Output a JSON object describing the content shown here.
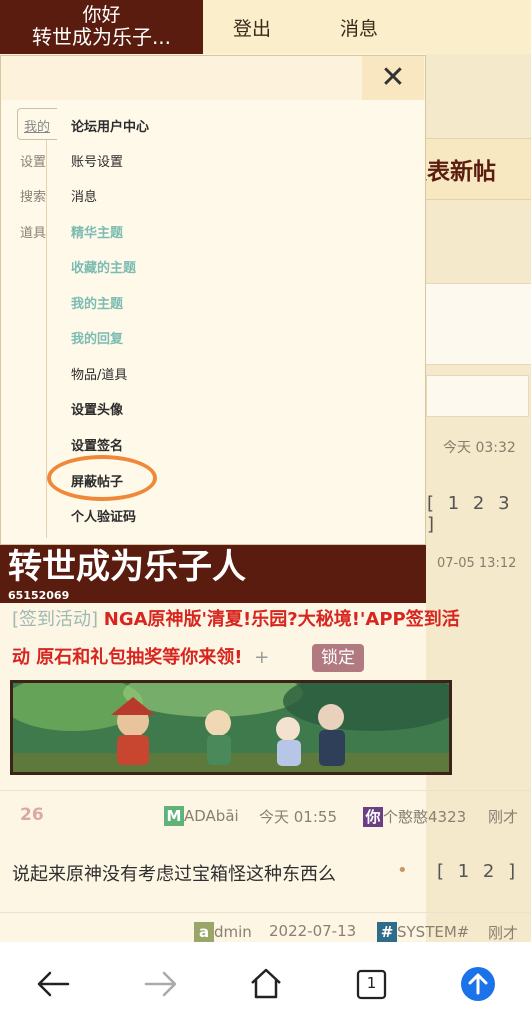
{
  "topbar": {
    "greeting": "你好",
    "username_short": "转世成为乐子...",
    "logout": "登出",
    "messages": "消息"
  },
  "background": {
    "post_button": "发表新帖",
    "date1": "今天 03:32",
    "pages1": "[ 1 2 3 ]",
    "date2": "07-05 13:12"
  },
  "menu": {
    "close": "✕",
    "left_tabs": [
      "我的",
      "设置",
      "搜索",
      "道具"
    ],
    "items": [
      {
        "label": "论坛用户中心"
      },
      {
        "label": "账号设置"
      },
      {
        "label": "消息"
      },
      {
        "label": "精华主题"
      },
      {
        "label": "收藏的主题"
      },
      {
        "label": "我的主题"
      },
      {
        "label": "我的回复"
      },
      {
        "label": "物品/道具"
      },
      {
        "label": "设置头像"
      },
      {
        "label": "设置签名"
      },
      {
        "label": "屏蔽帖子"
      },
      {
        "label": "个人验证码"
      }
    ]
  },
  "banner": {
    "title": "转世成为乐子人",
    "user_id": "65152069"
  },
  "posts": {
    "post1": {
      "tag": "[签到活动]",
      "title_line1": "NGA原神版'清夏!乐园?大秘境!'APP签到活",
      "title_line2": "动 原石和礼包抽奖等你来领!",
      "plus": "+",
      "badge": "锁定"
    },
    "post2": {
      "replies": "26",
      "author_badge": "M",
      "author": "ADAbāi",
      "time": "今天 01:55",
      "last_badge": "你",
      "last_user": "个憨憨4323",
      "last_time": "刚才",
      "title": "说起来原神没有考虑过宝箱怪这种东西么",
      "dot": "•",
      "pages": "[ 1 2 ]"
    },
    "post3": {
      "author_badge": "a",
      "author": "dmin",
      "time": "2022-07-13",
      "last_badge": "#",
      "last_user": "SYSTEM#",
      "last_time": "刚才"
    }
  },
  "bottom_nav": {
    "tab_count": "1"
  },
  "colors": {
    "brand_dark": "#5a1c0e",
    "highlight_ring": "#f0883a",
    "teal_item": "#7cbcb2",
    "upload_blue": "#1a73e8"
  }
}
